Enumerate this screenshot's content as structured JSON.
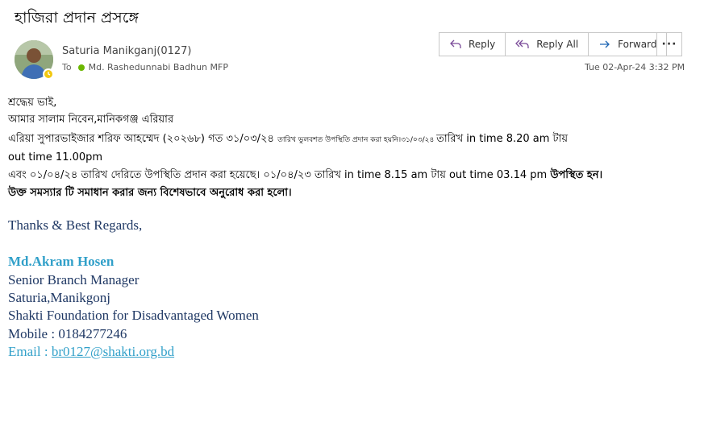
{
  "subject": "হাজিরা প্রদান প্রসঙ্গে",
  "sender": {
    "name": "Saturia Manikganj(0127)",
    "to_label": "To",
    "recipient": "Md. Rashedunnabi Badhun MFP"
  },
  "actions": {
    "reply": "Reply",
    "reply_all": "Reply All",
    "forward": "Forward",
    "more": "···"
  },
  "timestamp": "Tue 02-Apr-24 3:32 PM",
  "body": {
    "line1": "শ্রদ্ধেয় ভাই,",
    "line2": "আমার সালাম নিবেন,মানিকগঞ্জ এরিয়ার",
    "line3_a": "এরিয়া সুপারভাইজার  শরিফ আহম্মেদ (২০২৬৮) গত  ৩১/০৩/২৪ ",
    "line3_b": " তারিখ ভুলবশত উপস্থিতি প্রদান করা হয়নি।৩১/০৩/২৪ ",
    "line3_c": " তারিখ in time 8.20 am টায়",
    "line4": "out time 11.00pm",
    "line5_a": "এবং ০১/০৪/২৪ তারিখ  দেরিতে উপস্থিতি প্রদান করা হয়েছে। ০১/০৪/২৩ তারিখ  in time 8.15 am টায়  out time 03.14 pm ",
    "line5_b": "উপস্থিত হন।",
    "line6": "উক্ত সমস্যার টি সমাধান করার জন্য বিশেষভাবে অনুরোধ করা হলো।"
  },
  "signature": {
    "regards": "Thanks & Best Regards,",
    "name": "Md.Akram Hosen",
    "title": "Senior  Branch Manager",
    "location": "Saturia,Manikgonj",
    "org": "Shakti Foundation for Disadvantaged Women",
    "mobile": "Mobile : 0184277246",
    "email_label": "Email : ",
    "email": "br0127@shakti.org.bd"
  },
  "colors": {
    "link": "#31a0c9",
    "signature_text": "#1f3864",
    "presence": "#f2c811",
    "recipient_status": "#6bb700"
  }
}
